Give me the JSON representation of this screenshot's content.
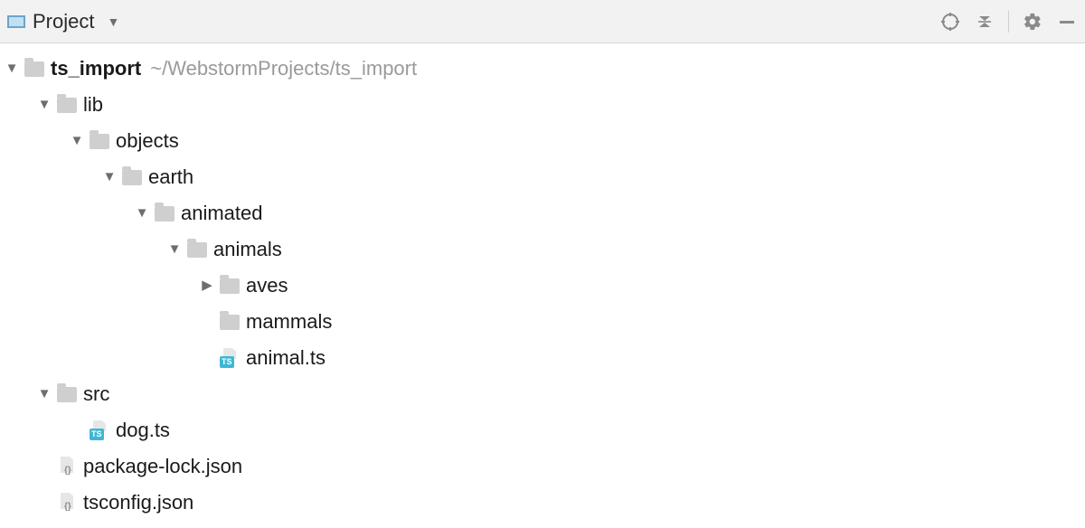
{
  "toolbar": {
    "view_label": "Project"
  },
  "tree": {
    "root": {
      "name": "ts_import",
      "path": "~/WebstormProjects/ts_import"
    },
    "lib": "lib",
    "objects": "objects",
    "earth": "earth",
    "animated": "animated",
    "animals": "animals",
    "aves": "aves",
    "mammals": "mammals",
    "animal_ts": "animal.ts",
    "src": "src",
    "dog_ts": "dog.ts",
    "package_lock": "package-lock.json",
    "tsconfig": "tsconfig.json"
  }
}
